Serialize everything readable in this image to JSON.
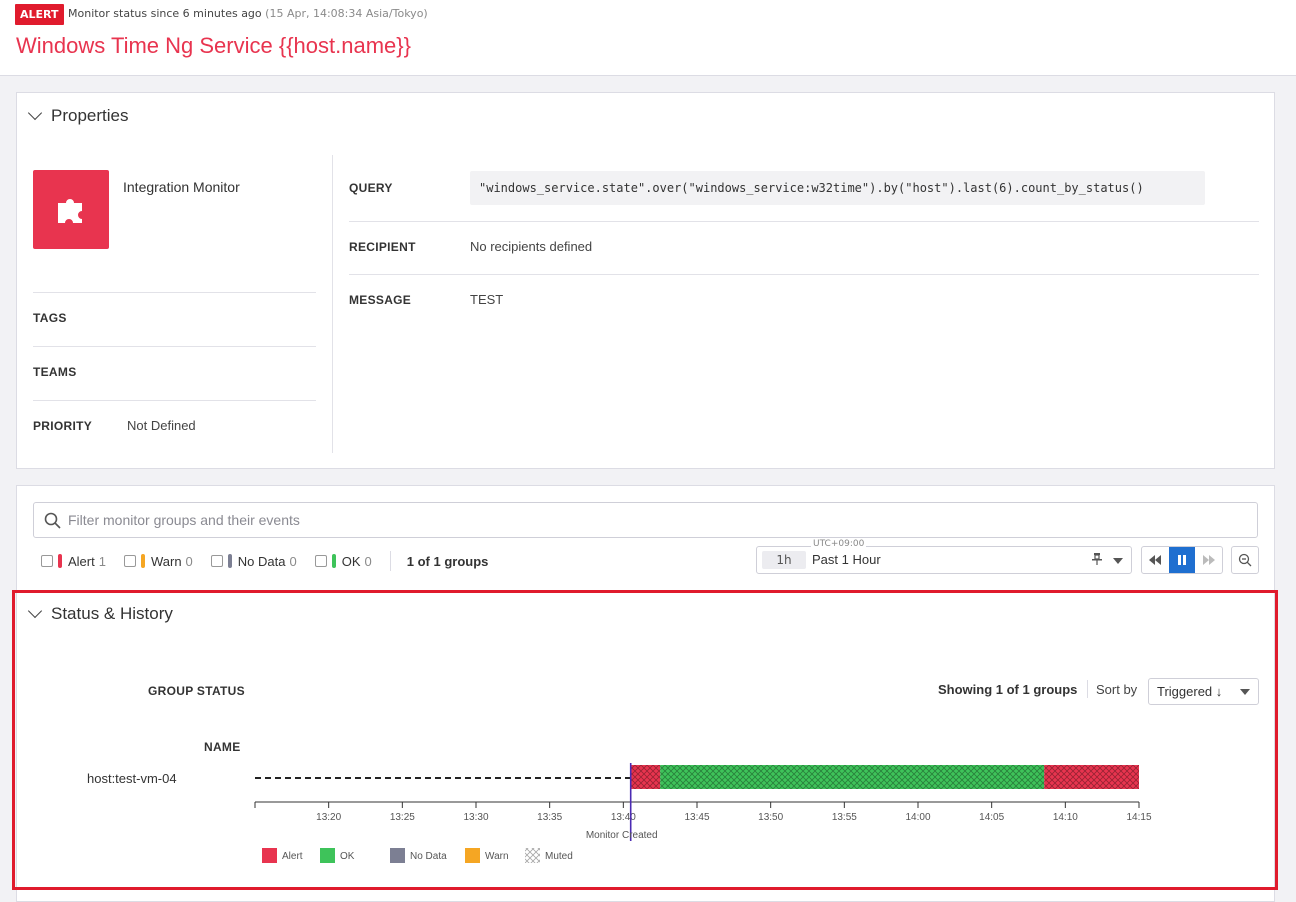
{
  "header": {
    "badge": "ALERT",
    "status_text": "Monitor status since 6 minutes ago",
    "status_time": "(15 Apr, 14:08:34 Asia/Tokyo)",
    "title": "Windows Time Ng Service {{host.name}}"
  },
  "properties": {
    "heading": "Properties",
    "monitor_type": "Integration Monitor",
    "tags_label": "TAGS",
    "teams_label": "TEAMS",
    "priority_label": "PRIORITY",
    "priority_value": "Not Defined",
    "query_label": "QUERY",
    "query_value": "\"windows_service.state\".over(\"windows_service:w32time\").by(\"host\").last(6).count_by_status()",
    "recipient_label": "RECIPIENT",
    "recipient_value": "No recipients defined",
    "message_label": "MESSAGE",
    "message_value": "TEST"
  },
  "filter": {
    "placeholder": "Filter monitor groups and their events",
    "items": [
      {
        "label": "Alert",
        "count": "1",
        "color": "#e8344f"
      },
      {
        "label": "Warn",
        "count": "0",
        "color": "#f5a623"
      },
      {
        "label": "No Data",
        "count": "0",
        "color": "#7c7f93"
      },
      {
        "label": "OK",
        "count": "0",
        "color": "#3ec35a"
      }
    ],
    "groups_text": "1 of 1 groups"
  },
  "timepicker": {
    "timezone": "UTC+09:00",
    "short": "1h",
    "label": "Past 1 Hour"
  },
  "status_history": {
    "heading": "Status & History",
    "group_status_label": "GROUP STATUS",
    "showing_text": "Showing 1 of 1 groups",
    "sort_label": "Sort by",
    "sort_value": "Triggered ↓",
    "name_label": "NAME",
    "rows": [
      {
        "name": "host:test-vm-04"
      }
    ]
  },
  "chart_data": {
    "type": "timeline",
    "x_range": [
      "13:15",
      "14:15"
    ],
    "tick_labels": [
      "13:20",
      "13:25",
      "13:30",
      "13:35",
      "13:40",
      "13:45",
      "13:50",
      "13:55",
      "14:00",
      "14:05",
      "14:10",
      "14:15"
    ],
    "annotation": {
      "label": "Monitor Created",
      "time": "13:40:30"
    },
    "segments": [
      {
        "status": "Alert",
        "start": "13:40:30",
        "end": "13:42:30"
      },
      {
        "status": "OK",
        "start": "13:42:30",
        "end": "14:08:34"
      },
      {
        "status": "Alert",
        "start": "14:08:34",
        "end": "14:15:00"
      }
    ],
    "legend": [
      {
        "label": "Alert",
        "color": "#e8344f"
      },
      {
        "label": "OK",
        "color": "#3ec35a"
      },
      {
        "label": "No Data",
        "color": "#7c7f93"
      },
      {
        "label": "Warn",
        "color": "#f5a623"
      },
      {
        "label": "Muted",
        "color": "#ffffff"
      }
    ]
  }
}
